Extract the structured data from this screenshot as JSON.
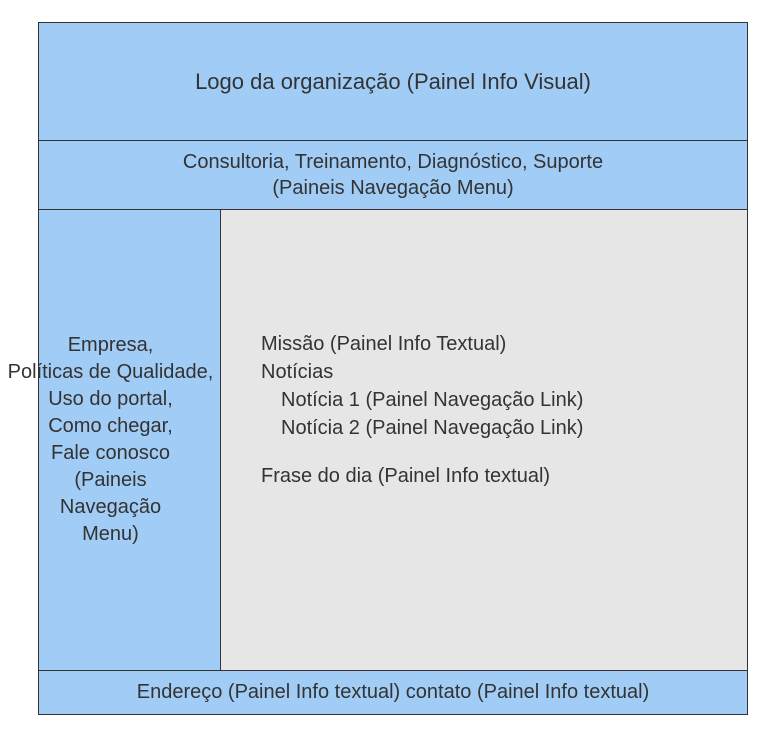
{
  "header": {
    "logo_text": "Logo da organização (Painel Info Visual)"
  },
  "topnav": {
    "line1": "Consultoria, Treinamento, Diagnóstico, Suporte",
    "line2": "(Paineis Navegação Menu)"
  },
  "sidebar": {
    "line1": "Empresa,",
    "line2": "Políticas de Qualidade,",
    "line3": "Uso do portal,",
    "line4": "Como chegar,",
    "line5": "Fale conosco",
    "line6": "(Paineis",
    "line7": "Navegação",
    "line8": "Menu)"
  },
  "main": {
    "missao": "Missão (Painel Info Textual)",
    "noticias_label": "Notícias",
    "noticia1": "Notícia 1 (Painel Navegação Link)",
    "noticia2": "Notícia 2 (Painel Navegação Link)",
    "frase": "Frase do dia (Painel Info textual)"
  },
  "footer": {
    "text": "Endereço (Painel Info textual) contato (Painel Info textual)"
  }
}
